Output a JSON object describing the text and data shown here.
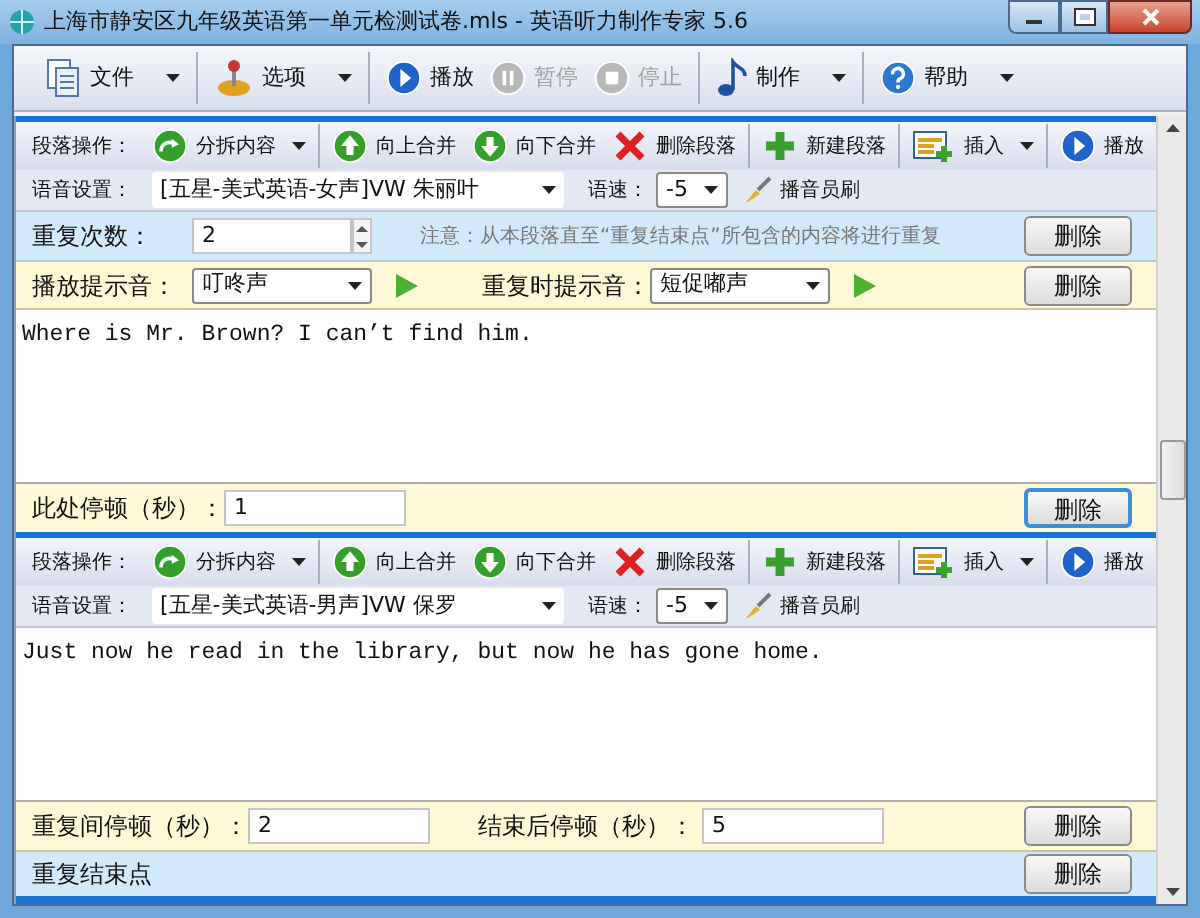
{
  "window": {
    "title": "上海市静安区九年级英语第一单元检测试卷.mls - 英语听力制作专家 5.6"
  },
  "toolbar": [
    [
      {
        "label": "文件",
        "dropdown": true,
        "disabled": false
      }
    ],
    [
      {
        "label": "选项",
        "dropdown": true,
        "disabled": false
      }
    ],
    [
      {
        "label": "播放",
        "dropdown": false,
        "disabled": false
      },
      {
        "label": "暂停",
        "dropdown": false,
        "disabled": true
      },
      {
        "label": "停止",
        "dropdown": false,
        "disabled": true
      }
    ],
    [
      {
        "label": "制作",
        "dropdown": true,
        "disabled": false
      }
    ],
    [
      {
        "label": "帮助",
        "dropdown": true,
        "disabled": false
      }
    ]
  ],
  "rows": [
    {
      "kind": "header",
      "ops_label": "段落操作：",
      "tools": [
        [
          {
            "label": "分拆内容",
            "dropdown": true
          }
        ],
        [
          {
            "label": "向上合并",
            "dropdown": false
          },
          {
            "label": "向下合并",
            "dropdown": false
          },
          {
            "label": "删除段落",
            "dropdown": false
          }
        ],
        [
          {
            "label": "新建段落",
            "dropdown": false
          }
        ],
        [
          {
            "label": "插入",
            "dropdown": true
          }
        ],
        [
          {
            "label": "播放",
            "dropdown": false
          }
        ]
      ],
      "voice_label": "语音设置：",
      "voice": "[五星-美式英语-女声]VW 朱丽叶",
      "speed_label": "语速：",
      "speed": "-5",
      "brush": "播音员刷"
    },
    {
      "kind": "repeat",
      "label": "重复次数：",
      "value": "2",
      "note": "注意：从本段落直至“重复结束点”所包含的内容将进行重复",
      "button": {
        "label": "删除",
        "focused": false
      }
    },
    {
      "kind": "tones",
      "label": "播放提示音：",
      "value": "叮咚声",
      "label2": "重复时提示音：",
      "value2": "短促嘟声",
      "button": {
        "label": "删除",
        "focused": false
      }
    },
    {
      "kind": "text",
      "text": "Where is Mr. Brown? I can’t find him."
    },
    {
      "kind": "pause",
      "label": "此处停顿（秒）：",
      "value": "1",
      "button": {
        "label": "删除",
        "focused": true
      }
    },
    {
      "kind": "header",
      "ops_label": "段落操作：",
      "tools": [
        [
          {
            "label": "分拆内容",
            "dropdown": true
          }
        ],
        [
          {
            "label": "向上合并",
            "dropdown": false
          },
          {
            "label": "向下合并",
            "dropdown": false
          },
          {
            "label": "删除段落",
            "dropdown": false
          }
        ],
        [
          {
            "label": "新建段落",
            "dropdown": false
          }
        ],
        [
          {
            "label": "插入",
            "dropdown": true
          }
        ],
        [
          {
            "label": "播放",
            "dropdown": false
          }
        ]
      ],
      "voice_label": "语音设置：",
      "voice": "[五星-美式英语-男声]VW 保罗",
      "speed_label": "语速：",
      "speed": "-5",
      "brush": "播音员刷"
    },
    {
      "kind": "text",
      "text": "Just now he read in the library, but now he has gone home."
    },
    {
      "kind": "repeat_pause",
      "label": "重复间停顿（秒）：",
      "value": "2",
      "label2": "结束后停顿（秒）：",
      "value2": "5",
      "button": {
        "label": "删除",
        "focused": false
      }
    },
    {
      "kind": "repeat_end",
      "label": "重复结束点",
      "button": {
        "label": "删除",
        "focused": false
      }
    }
  ]
}
